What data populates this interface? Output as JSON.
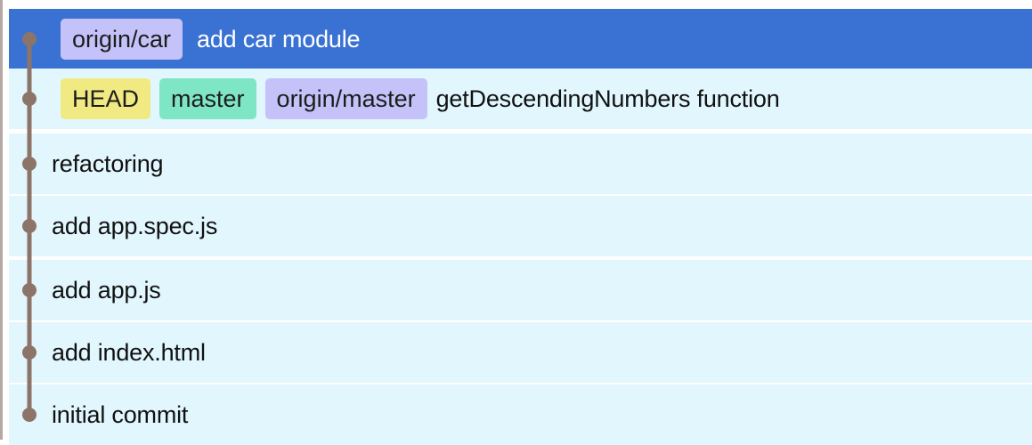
{
  "commits": [
    {
      "refs": [
        {
          "label": "origin/car",
          "kind": "remote"
        }
      ],
      "message": "add car module",
      "selected": true
    },
    {
      "refs": [
        {
          "label": "HEAD",
          "kind": "head"
        },
        {
          "label": "master",
          "kind": "local"
        },
        {
          "label": "origin/master",
          "kind": "remote"
        }
      ],
      "message": "getDescendingNumbers function",
      "selected": false
    },
    {
      "refs": [],
      "message": "refactoring",
      "selected": false
    },
    {
      "refs": [],
      "message": "add app.spec.js",
      "selected": false
    },
    {
      "refs": [],
      "message": "add app.js",
      "selected": false
    },
    {
      "refs": [],
      "message": "add index.html",
      "selected": false
    },
    {
      "refs": [],
      "message": "initial commit",
      "selected": false
    }
  ],
  "colors": {
    "selected_row": "#3a72d3",
    "row_background": "#e2f6fe",
    "graph_line": "#8c7469",
    "tag_remote": "#c5c2f9",
    "tag_head": "#f1ea82",
    "tag_local": "#7fe6c5"
  }
}
